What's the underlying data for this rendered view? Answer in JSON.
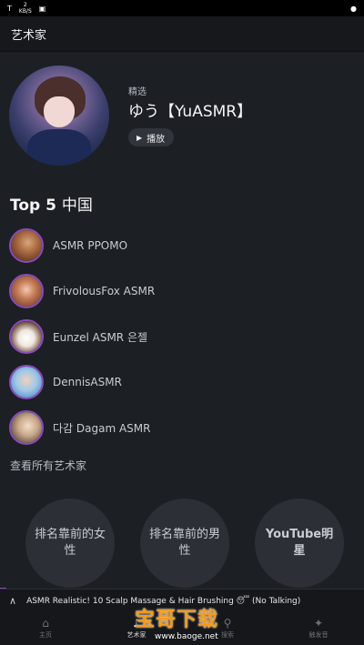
{
  "statusbar": {
    "left_icon": "T",
    "net_speed_value": "2",
    "net_speed_unit": "KB/S",
    "image_icon": "image-icon",
    "right_dot": "●"
  },
  "appbar": {
    "title": "艺术家"
  },
  "featured": {
    "label": "精选",
    "title": "ゆう【YuASMR】",
    "play_label": "播放",
    "play_icon": "▶"
  },
  "top5": {
    "title_bold": "Top 5",
    "title_rest": "中国",
    "artists": [
      {
        "name": "ASMR PPOMO"
      },
      {
        "name": "FrivolousFox ASMR"
      },
      {
        "name": "Eunzel ASMR 은젤"
      },
      {
        "name": "DennisASMR"
      },
      {
        "name": "다감 Dagam ASMR"
      }
    ]
  },
  "view_all": "查看所有艺术家",
  "categories": [
    {
      "label": "排名靠前的女性"
    },
    {
      "label": "排名靠前的男性"
    },
    {
      "label": "YouTube明星"
    }
  ],
  "now_playing": {
    "chevron": "∧",
    "track": "ASMR Realistic! 10 Scalp Massage & Hair Brushing 😴 (No Talking)"
  },
  "bottom_nav": [
    {
      "label": "主页",
      "icon": "home-icon",
      "glyph": "⌂"
    },
    {
      "label": "艺术家",
      "icon": "artist-icon",
      "glyph": "♪"
    },
    {
      "label": "搜索",
      "icon": "search-icon",
      "glyph": "⚲"
    },
    {
      "label": "触发音",
      "icon": "sparkle-icon",
      "glyph": "✦"
    }
  ],
  "watermark": {
    "text": "宝哥下载",
    "url": "www.baoge.net"
  },
  "colors": {
    "accent": "#8a4bbd",
    "background": "#1c1f24",
    "watermark": "#f39a1e"
  }
}
